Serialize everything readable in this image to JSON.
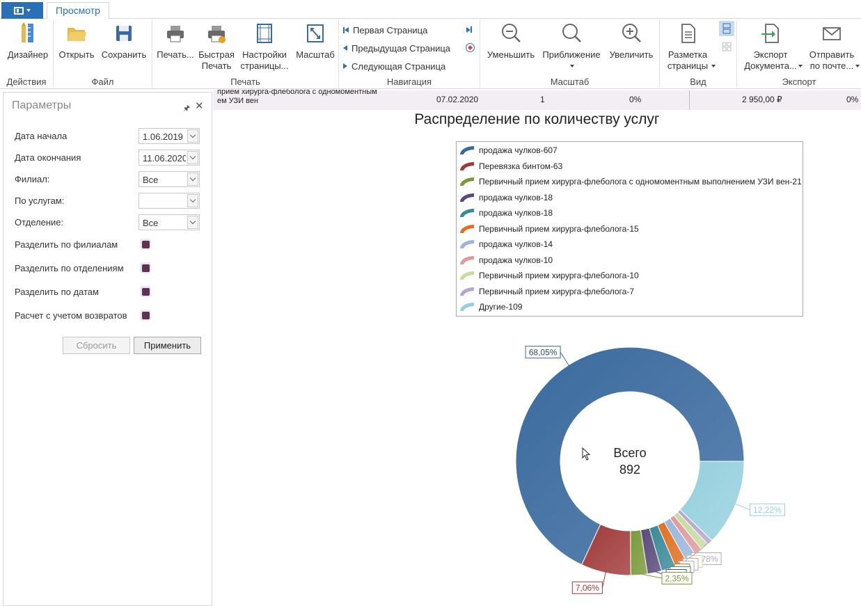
{
  "tabs": {
    "active": "Просмотр"
  },
  "ribbon": {
    "groups": [
      {
        "label": "Действия"
      },
      {
        "label": "Файл"
      },
      {
        "label": "Печать"
      },
      {
        "label": "Навигация"
      },
      {
        "label": "Масштаб"
      },
      {
        "label": "Вид"
      },
      {
        "label": "Экспорт"
      }
    ],
    "buttons": {
      "designer": "Дизайнер",
      "open": "Открыть",
      "save": "Сохранить",
      "print": "Печать...",
      "quick_print": "Быстрая\nПечать",
      "page_setup": "Настройки\nстраницы...",
      "scale": "Масштаб",
      "zoom_out": "Уменьшить",
      "zoom": "Приближение",
      "zoom_in": "Увеличить",
      "page_layout": "Разметка\nстраницы",
      "export_doc": "Экспорт\nДокумента...",
      "send_mail": "Отправить\nпо почте..."
    },
    "nav": {
      "first": "Первая Страница",
      "prev": "Предыдущая Страница",
      "next": "Следующая Страница"
    }
  },
  "params": {
    "title": "Параметры",
    "fields": [
      {
        "label": "Дата начала",
        "value": "1.06.2019"
      },
      {
        "label": "Дата окончания",
        "value": "11.06.2020"
      },
      {
        "label": "Филиал:",
        "value": "Все"
      },
      {
        "label": "По услугам:",
        "value": ""
      },
      {
        "label": "Отделение:",
        "value": "Все"
      }
    ],
    "checks": [
      {
        "label": "Разделить по филиалам"
      },
      {
        "label": "Разделить по отделениям"
      },
      {
        "label": "Разделить по датам"
      },
      {
        "label": "Расчет с учетом возвратов"
      }
    ],
    "reset_label": "Сбросить",
    "apply_label": "Применить"
  },
  "report_row": {
    "service": "прием хирурга-флеболога с одномоментным\nем УЗИ вен",
    "date": "07.02.2020",
    "count": "1",
    "pct": "0%",
    "amount": "2 950,00 ₽",
    "pct2": "0%"
  },
  "chart_data": {
    "type": "pie",
    "title": "Распределение по количеству услуг",
    "center_label": "Всего",
    "total": 892,
    "legend": [
      "продажа чулков-607",
      "Перевязка бинтом-63",
      "Первичный прием хирурга-флеболога с одномоментным выполнением УЗИ вен-21",
      "продажа чулков-18",
      "продажа чулков-18",
      "Первичный прием хирурга-флеболога-15",
      "продажа чулков-14",
      "продажа чулков-10",
      "Первичный прием хирурга-флеболога-10",
      "Первичный прием хирурга-флеболога-7",
      "Другие-109"
    ],
    "values": [
      607,
      63,
      21,
      18,
      18,
      15,
      14,
      10,
      10,
      7,
      109
    ],
    "colors": [
      "#3a6a9e",
      "#a03a3a",
      "#7a9a3a",
      "#5a4a7a",
      "#3a8a9a",
      "#e07020",
      "#9ab6dc",
      "#e09a9a",
      "#c6dca0",
      "#b6a6cc",
      "#96d0de"
    ],
    "data_labels": [
      "68,05%",
      "7,06%",
      "2,35%",
      "2,0",
      "2,0",
      "1,",
      "1,",
      "1,",
      "1,",
      "0,78%",
      "12,22%"
    ]
  }
}
